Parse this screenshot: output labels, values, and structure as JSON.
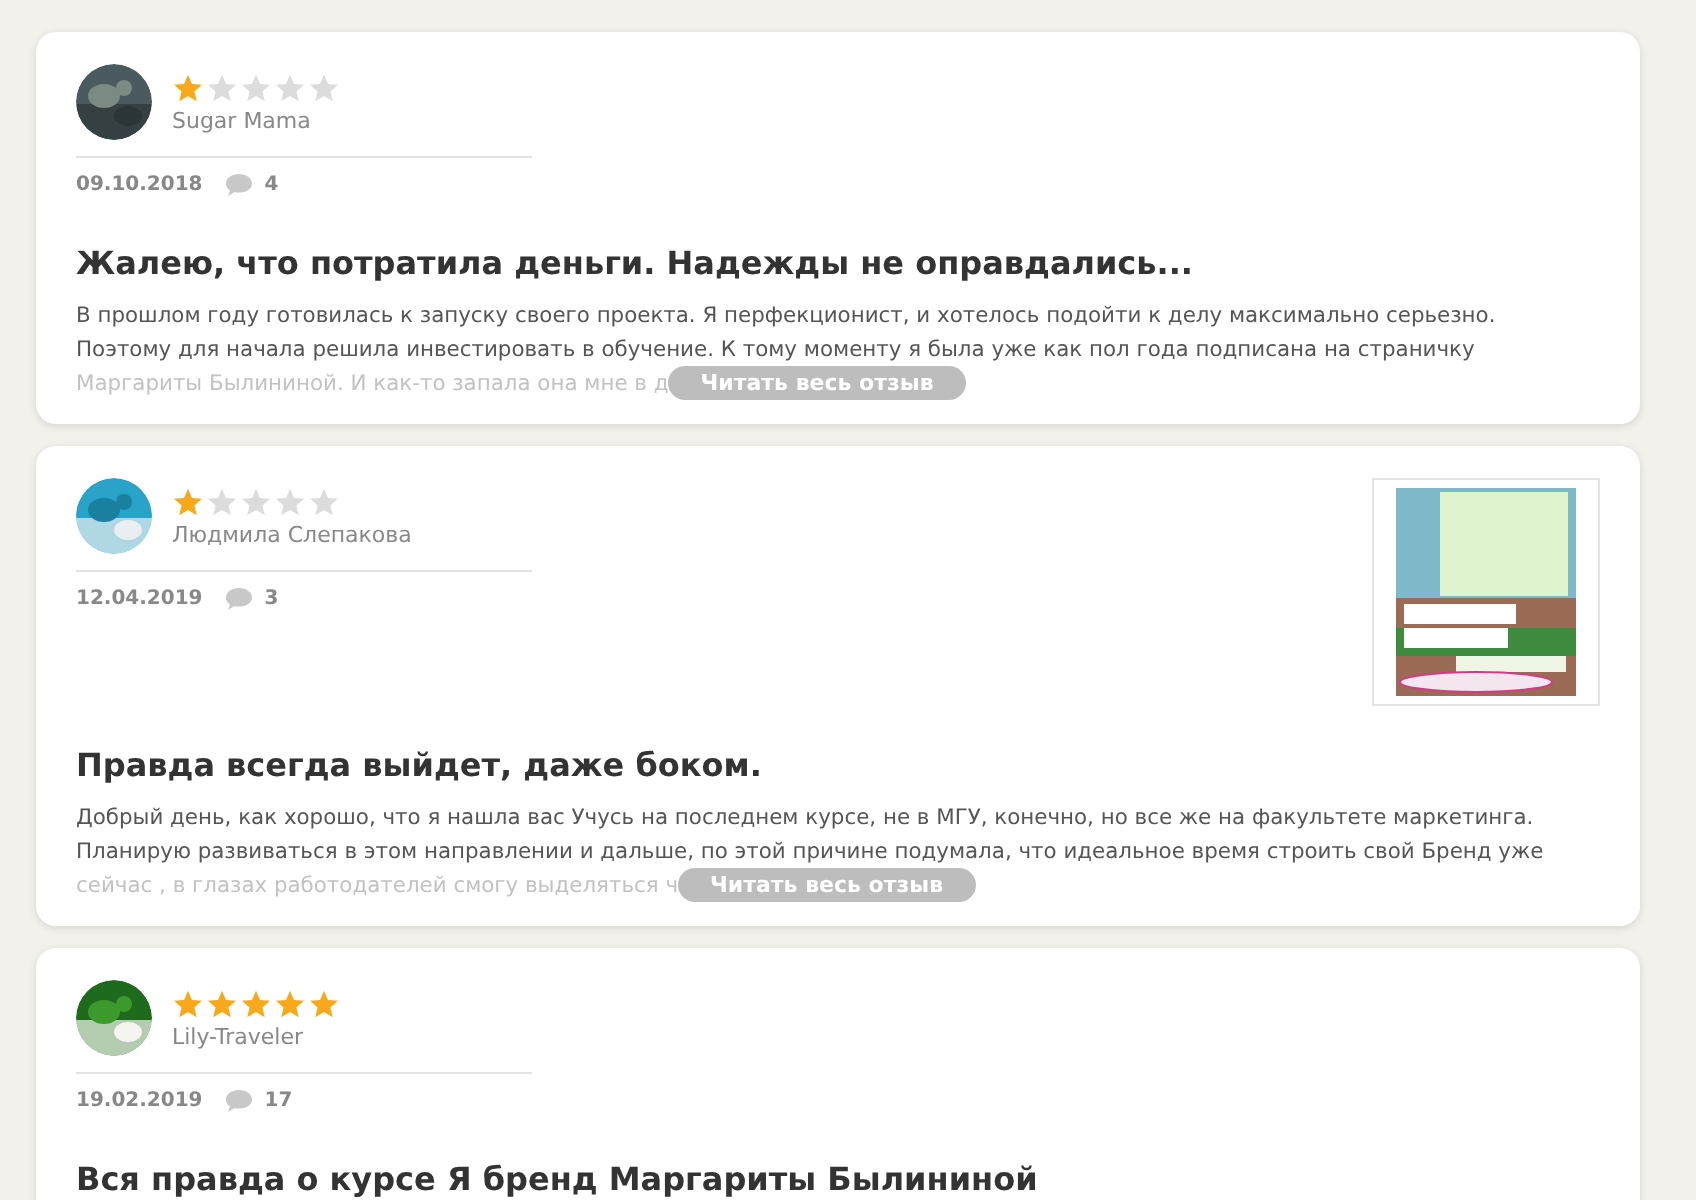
{
  "reviews": [
    {
      "author": "Sugar Mama",
      "stars": 1,
      "date": "09.10.2018",
      "comments": "4",
      "title": "Жалею, что потратила деньги. Надежды не оправдались...",
      "lines": [
        "В прошлом году готовилась к запуску своего проекта. Я перфекционист, и хотелось подойти к делу максимально серьезно.",
        "Поэтому для начала решила инвестировать в обучение. К тому моменту я была уже как пол года подписана на страничку",
        "Маргариты Былининой. И как-то запала она мне в д"
      ],
      "read_more": "Читать весь отзыв"
    },
    {
      "author": "Людмила Слепакова",
      "stars": 1,
      "date": "12.04.2019",
      "comments": "3",
      "title": "Правда всегда выйдет, даже боком.",
      "lines": [
        "Добрый день, как хорошо, что я нашла вас Учусь на последнем курсе, не в МГУ, конечно, но все же на факультете маркетинга.",
        "Планирую развиваться в этом направлении и дальше, по этой причине подумала, что идеальное время строить свой Бренд уже",
        "сейчас , в глазах работодателей смогу выделяться ч"
      ],
      "read_more": "Читать весь отзыв"
    },
    {
      "author": "Lily-Traveler",
      "stars": 5,
      "date": "19.02.2019",
      "comments": "17",
      "title": "Вся правда о курсе Я бренд Маргариты Былининой"
    }
  ]
}
